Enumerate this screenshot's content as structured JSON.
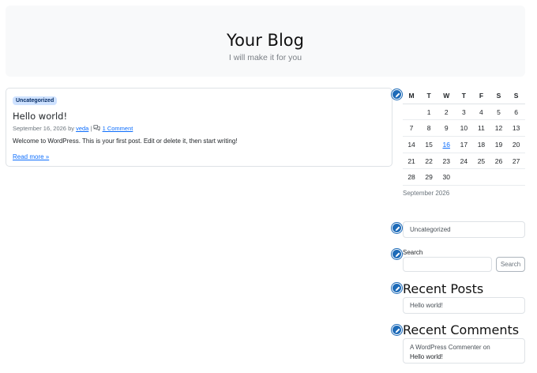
{
  "header": {
    "title": "Your Blog",
    "tagline": "I will make it for you"
  },
  "post": {
    "category": "Uncategorized",
    "title": "Hello world!",
    "date": "September 16, 2026",
    "by": "by",
    "author": "veda",
    "separator": "|",
    "comments_link": "1 Comment",
    "excerpt": "Welcome to WordPress. This is your first post. Edit or delete it, then start writing!",
    "read_more": "Read more »"
  },
  "calendar": {
    "weekdays": [
      "M",
      "T",
      "W",
      "T",
      "F",
      "S",
      "S"
    ],
    "weeks": [
      [
        "",
        "1",
        "2",
        "3",
        "4",
        "5",
        "6"
      ],
      [
        "7",
        "8",
        "9",
        "10",
        "11",
        "12",
        "13"
      ],
      [
        "14",
        "15",
        "16",
        "17",
        "18",
        "19",
        "20"
      ],
      [
        "21",
        "22",
        "23",
        "24",
        "25",
        "26",
        "27"
      ],
      [
        "28",
        "29",
        "30",
        "",
        "",
        "",
        ""
      ]
    ],
    "linked_day": "16",
    "caption": "September 2026"
  },
  "categories_widget": {
    "items": [
      "Uncategorized"
    ]
  },
  "search_widget": {
    "label": "Search",
    "value": "",
    "button": "Search"
  },
  "recent_posts": {
    "heading": "Recent Posts",
    "items": [
      "Hello world!"
    ]
  },
  "recent_comments": {
    "heading": "Recent Comments",
    "author": "A WordPress Commenter",
    "on": "on",
    "post": "Hello world!"
  },
  "colors": {
    "accent": "#0d6efd",
    "edit_button": "#1e6bb8",
    "header_bg": "#f8f9fa",
    "badge_bg": "#cfe2ff"
  },
  "icons": {
    "edit": "pencil-icon",
    "comments": "comments-icon"
  }
}
